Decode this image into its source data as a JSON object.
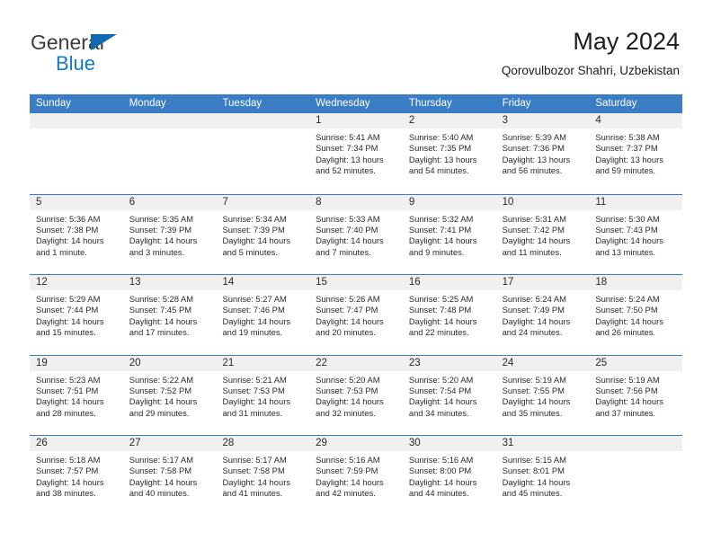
{
  "brand": {
    "name_top": "General",
    "name_bottom": "Blue",
    "color_blue": "#1479c4",
    "color_dark": "#3d3d3d"
  },
  "header": {
    "title": "May 2024",
    "subtitle": "Qorovulbozor Shahri, Uzbekistan"
  },
  "calendar": {
    "accent_color": "#3b7dc4",
    "weekdays": [
      "Sunday",
      "Monday",
      "Tuesday",
      "Wednesday",
      "Thursday",
      "Friday",
      "Saturday"
    ],
    "weeks": [
      [
        {
          "day": "",
          "lines": []
        },
        {
          "day": "",
          "lines": []
        },
        {
          "day": "",
          "lines": []
        },
        {
          "day": "1",
          "lines": [
            "Sunrise: 5:41 AM",
            "Sunset: 7:34 PM",
            "Daylight: 13 hours",
            "and 52 minutes."
          ]
        },
        {
          "day": "2",
          "lines": [
            "Sunrise: 5:40 AM",
            "Sunset: 7:35 PM",
            "Daylight: 13 hours",
            "and 54 minutes."
          ]
        },
        {
          "day": "3",
          "lines": [
            "Sunrise: 5:39 AM",
            "Sunset: 7:36 PM",
            "Daylight: 13 hours",
            "and 56 minutes."
          ]
        },
        {
          "day": "4",
          "lines": [
            "Sunrise: 5:38 AM",
            "Sunset: 7:37 PM",
            "Daylight: 13 hours",
            "and 59 minutes."
          ]
        }
      ],
      [
        {
          "day": "5",
          "lines": [
            "Sunrise: 5:36 AM",
            "Sunset: 7:38 PM",
            "Daylight: 14 hours",
            "and 1 minute."
          ]
        },
        {
          "day": "6",
          "lines": [
            "Sunrise: 5:35 AM",
            "Sunset: 7:39 PM",
            "Daylight: 14 hours",
            "and 3 minutes."
          ]
        },
        {
          "day": "7",
          "lines": [
            "Sunrise: 5:34 AM",
            "Sunset: 7:39 PM",
            "Daylight: 14 hours",
            "and 5 minutes."
          ]
        },
        {
          "day": "8",
          "lines": [
            "Sunrise: 5:33 AM",
            "Sunset: 7:40 PM",
            "Daylight: 14 hours",
            "and 7 minutes."
          ]
        },
        {
          "day": "9",
          "lines": [
            "Sunrise: 5:32 AM",
            "Sunset: 7:41 PM",
            "Daylight: 14 hours",
            "and 9 minutes."
          ]
        },
        {
          "day": "10",
          "lines": [
            "Sunrise: 5:31 AM",
            "Sunset: 7:42 PM",
            "Daylight: 14 hours",
            "and 11 minutes."
          ]
        },
        {
          "day": "11",
          "lines": [
            "Sunrise: 5:30 AM",
            "Sunset: 7:43 PM",
            "Daylight: 14 hours",
            "and 13 minutes."
          ]
        }
      ],
      [
        {
          "day": "12",
          "lines": [
            "Sunrise: 5:29 AM",
            "Sunset: 7:44 PM",
            "Daylight: 14 hours",
            "and 15 minutes."
          ]
        },
        {
          "day": "13",
          "lines": [
            "Sunrise: 5:28 AM",
            "Sunset: 7:45 PM",
            "Daylight: 14 hours",
            "and 17 minutes."
          ]
        },
        {
          "day": "14",
          "lines": [
            "Sunrise: 5:27 AM",
            "Sunset: 7:46 PM",
            "Daylight: 14 hours",
            "and 19 minutes."
          ]
        },
        {
          "day": "15",
          "lines": [
            "Sunrise: 5:26 AM",
            "Sunset: 7:47 PM",
            "Daylight: 14 hours",
            "and 20 minutes."
          ]
        },
        {
          "day": "16",
          "lines": [
            "Sunrise: 5:25 AM",
            "Sunset: 7:48 PM",
            "Daylight: 14 hours",
            "and 22 minutes."
          ]
        },
        {
          "day": "17",
          "lines": [
            "Sunrise: 5:24 AM",
            "Sunset: 7:49 PM",
            "Daylight: 14 hours",
            "and 24 minutes."
          ]
        },
        {
          "day": "18",
          "lines": [
            "Sunrise: 5:24 AM",
            "Sunset: 7:50 PM",
            "Daylight: 14 hours",
            "and 26 minutes."
          ]
        }
      ],
      [
        {
          "day": "19",
          "lines": [
            "Sunrise: 5:23 AM",
            "Sunset: 7:51 PM",
            "Daylight: 14 hours",
            "and 28 minutes."
          ]
        },
        {
          "day": "20",
          "lines": [
            "Sunrise: 5:22 AM",
            "Sunset: 7:52 PM",
            "Daylight: 14 hours",
            "and 29 minutes."
          ]
        },
        {
          "day": "21",
          "lines": [
            "Sunrise: 5:21 AM",
            "Sunset: 7:53 PM",
            "Daylight: 14 hours",
            "and 31 minutes."
          ]
        },
        {
          "day": "22",
          "lines": [
            "Sunrise: 5:20 AM",
            "Sunset: 7:53 PM",
            "Daylight: 14 hours",
            "and 32 minutes."
          ]
        },
        {
          "day": "23",
          "lines": [
            "Sunrise: 5:20 AM",
            "Sunset: 7:54 PM",
            "Daylight: 14 hours",
            "and 34 minutes."
          ]
        },
        {
          "day": "24",
          "lines": [
            "Sunrise: 5:19 AM",
            "Sunset: 7:55 PM",
            "Daylight: 14 hours",
            "and 35 minutes."
          ]
        },
        {
          "day": "25",
          "lines": [
            "Sunrise: 5:19 AM",
            "Sunset: 7:56 PM",
            "Daylight: 14 hours",
            "and 37 minutes."
          ]
        }
      ],
      [
        {
          "day": "26",
          "lines": [
            "Sunrise: 5:18 AM",
            "Sunset: 7:57 PM",
            "Daylight: 14 hours",
            "and 38 minutes."
          ]
        },
        {
          "day": "27",
          "lines": [
            "Sunrise: 5:17 AM",
            "Sunset: 7:58 PM",
            "Daylight: 14 hours",
            "and 40 minutes."
          ]
        },
        {
          "day": "28",
          "lines": [
            "Sunrise: 5:17 AM",
            "Sunset: 7:58 PM",
            "Daylight: 14 hours",
            "and 41 minutes."
          ]
        },
        {
          "day": "29",
          "lines": [
            "Sunrise: 5:16 AM",
            "Sunset: 7:59 PM",
            "Daylight: 14 hours",
            "and 42 minutes."
          ]
        },
        {
          "day": "30",
          "lines": [
            "Sunrise: 5:16 AM",
            "Sunset: 8:00 PM",
            "Daylight: 14 hours",
            "and 44 minutes."
          ]
        },
        {
          "day": "31",
          "lines": [
            "Sunrise: 5:15 AM",
            "Sunset: 8:01 PM",
            "Daylight: 14 hours",
            "and 45 minutes."
          ]
        },
        {
          "day": "",
          "lines": []
        }
      ]
    ]
  }
}
